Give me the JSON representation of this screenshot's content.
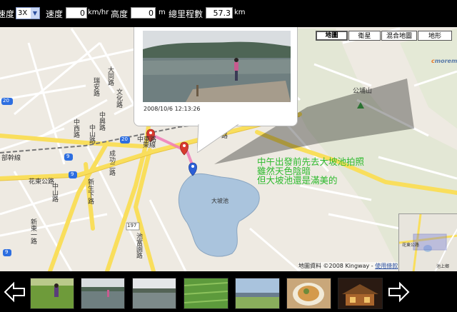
{
  "toolbar": {
    "zoom_label": "速度",
    "zoom_value": "3X",
    "speed_label": "速度",
    "speed_value": "0",
    "speed_unit": "km/hr",
    "altitude_label": "高度",
    "altitude_value": "0",
    "altitude_unit": "m",
    "distance_label": "總里程數",
    "distance_value": "57.3",
    "distance_unit": "km"
  },
  "map_types": [
    {
      "label": "地圖",
      "active": true
    },
    {
      "label": "衛星",
      "active": false
    },
    {
      "label": "混合地圖",
      "active": false
    },
    {
      "label": "地形",
      "active": false
    }
  ],
  "logo": {
    "prefix": "c",
    "text": "moremap"
  },
  "map_labels": {
    "road_1": "大同路",
    "road_2": "瑞安路",
    "road_3": "文化路",
    "road_4": "中興路",
    "road_5": "中西路",
    "road_6": "中山路",
    "road_7": "中東路",
    "road_8": "東線",
    "road_9": "路",
    "railway": "部幹線",
    "road_10": "花東公路",
    "road_11": "中山路",
    "road_12": "新東一路",
    "road_13": "新生下路",
    "road_14": "成功二路",
    "road_15": "池富園路",
    "mountain": "公埔山",
    "lake": "大坡池",
    "shield_20_a": "20",
    "shield_20_b": "20",
    "shield_9_a": "9",
    "shield_9_b": "9",
    "shield_9_c": "9",
    "shield_197": "197"
  },
  "photo_popup": {
    "timestamp": "2008/10/6 12:13:26"
  },
  "caption": {
    "line1": "中午出發前先去大坡池拍照",
    "line2": "雖然天色陰暗",
    "line3": "但大坡池還是滿美的"
  },
  "copyright": {
    "text": "地圖資料 ©2008 Kingway - ",
    "link": "使用條款"
  },
  "minimap": {
    "label_1": "花東公路",
    "label_2": "池上鄉"
  },
  "thumbnails": [
    {
      "name": "field-person"
    },
    {
      "name": "lake-person"
    },
    {
      "name": "lake-gray"
    },
    {
      "name": "rice-field"
    },
    {
      "name": "landscape-sky"
    },
    {
      "name": "food-bowl"
    },
    {
      "name": "wooden-house"
    }
  ],
  "colors": {
    "road_major": "#f9de5c",
    "road_minor": "#ffffff",
    "lake": "#aac4dd",
    "land": "#eeeae2",
    "route": "#f07ab6",
    "caption": "#2dba2d"
  }
}
